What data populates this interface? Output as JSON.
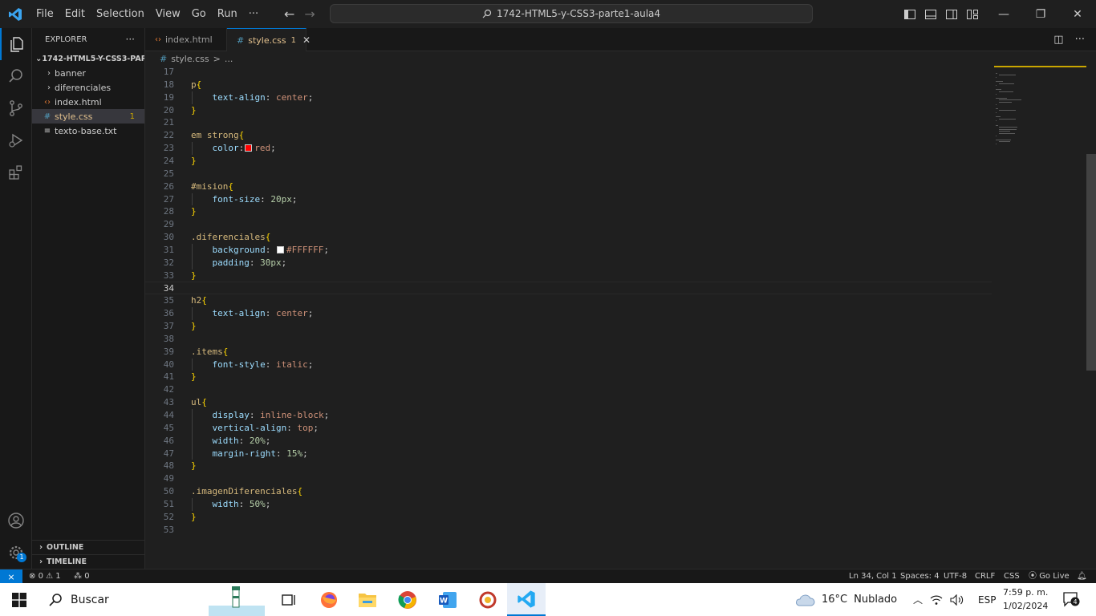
{
  "window": {
    "title": "1742-HTML5-y-CSS3-parte1-aula4",
    "menu": [
      "File",
      "Edit",
      "Selection",
      "View",
      "Go",
      "Run",
      "···"
    ],
    "controls": {
      "minimize": "—",
      "restore": "❐",
      "close": "✕"
    }
  },
  "explorer": {
    "title": "EXPLORER",
    "more": "···",
    "root": "1742-HTML5-Y-CSS3-PAR...",
    "items": [
      {
        "label": "banner",
        "type": "folder",
        "icon": "chevron-right-icon"
      },
      {
        "label": "diferenciales",
        "type": "folder",
        "icon": "chevron-right-icon"
      },
      {
        "label": "index.html",
        "type": "html",
        "icon": "html-file-icon"
      },
      {
        "label": "style.css",
        "type": "css",
        "icon": "css-file-icon",
        "problems": "1",
        "selected": true
      },
      {
        "label": "texto-base.txt",
        "type": "txt",
        "icon": "text-file-icon"
      }
    ],
    "outline": "OUTLINE",
    "timeline": "TIMELINE"
  },
  "tabs": [
    {
      "label": "index.html",
      "active": false,
      "icon": "html-file-icon"
    },
    {
      "label": "style.css",
      "active": true,
      "problems": "1",
      "close": "✕",
      "icon": "css-file-icon"
    }
  ],
  "breadcrumb": {
    "file": "style.css",
    "sep": ">",
    "rest": "..."
  },
  "editor": {
    "current_line": "34",
    "lines": [
      {
        "n": "17",
        "t": []
      },
      {
        "n": "18",
        "t": [
          [
            "sel",
            "p"
          ],
          [
            "brace",
            "{"
          ]
        ]
      },
      {
        "n": "19",
        "t": [
          [
            "ws",
            "    "
          ],
          [
            "prop",
            "text-align"
          ],
          [
            "plain",
            ": "
          ],
          [
            "val",
            "center"
          ],
          [
            "plain",
            ";"
          ]
        ]
      },
      {
        "n": "20",
        "t": [
          [
            "brace",
            "}"
          ]
        ]
      },
      {
        "n": "21",
        "t": []
      },
      {
        "n": "22",
        "t": [
          [
            "sel",
            "em strong"
          ],
          [
            "brace",
            "{"
          ]
        ]
      },
      {
        "n": "23",
        "t": [
          [
            "ws",
            "    "
          ],
          [
            "prop",
            "color"
          ],
          [
            "plain",
            ":"
          ],
          [
            "swatch",
            "#ff0000"
          ],
          [
            "val",
            "red"
          ],
          [
            "plain",
            ";"
          ]
        ]
      },
      {
        "n": "24",
        "t": [
          [
            "brace",
            "}"
          ]
        ]
      },
      {
        "n": "25",
        "t": []
      },
      {
        "n": "26",
        "t": [
          [
            "sel",
            "#mision"
          ],
          [
            "brace",
            "{"
          ]
        ]
      },
      {
        "n": "27",
        "t": [
          [
            "ws",
            "    "
          ],
          [
            "prop",
            "font-size"
          ],
          [
            "plain",
            ": "
          ],
          [
            "num",
            "20px"
          ],
          [
            "plain",
            ";"
          ]
        ]
      },
      {
        "n": "28",
        "t": [
          [
            "brace",
            "}"
          ]
        ]
      },
      {
        "n": "29",
        "t": []
      },
      {
        "n": "30",
        "t": [
          [
            "sel",
            ".diferenciales"
          ],
          [
            "brace",
            "{"
          ]
        ]
      },
      {
        "n": "31",
        "t": [
          [
            "ws",
            "    "
          ],
          [
            "prop",
            "background"
          ],
          [
            "plain",
            ": "
          ],
          [
            "swatch",
            "#ffffff"
          ],
          [
            "val",
            "#FFFFFF"
          ],
          [
            "plain",
            ";"
          ]
        ]
      },
      {
        "n": "32",
        "t": [
          [
            "ws",
            "    "
          ],
          [
            "prop",
            "padding"
          ],
          [
            "plain",
            ": "
          ],
          [
            "num",
            "30px"
          ],
          [
            "plain",
            ";"
          ]
        ]
      },
      {
        "n": "33",
        "t": [
          [
            "brace",
            "}"
          ]
        ]
      },
      {
        "n": "34",
        "t": []
      },
      {
        "n": "35",
        "t": [
          [
            "sel",
            "h2"
          ],
          [
            "brace",
            "{"
          ]
        ]
      },
      {
        "n": "36",
        "t": [
          [
            "ws",
            "    "
          ],
          [
            "prop",
            "text-align"
          ],
          [
            "plain",
            ": "
          ],
          [
            "val",
            "center"
          ],
          [
            "plain",
            ";"
          ]
        ]
      },
      {
        "n": "37",
        "t": [
          [
            "brace",
            "}"
          ]
        ]
      },
      {
        "n": "38",
        "t": []
      },
      {
        "n": "39",
        "t": [
          [
            "sel",
            ".items"
          ],
          [
            "brace",
            "{"
          ]
        ]
      },
      {
        "n": "40",
        "t": [
          [
            "ws",
            "    "
          ],
          [
            "prop",
            "font-style"
          ],
          [
            "plain",
            ": "
          ],
          [
            "val",
            "italic"
          ],
          [
            "plain",
            ";"
          ]
        ]
      },
      {
        "n": "41",
        "t": [
          [
            "brace",
            "}"
          ]
        ]
      },
      {
        "n": "42",
        "t": []
      },
      {
        "n": "43",
        "t": [
          [
            "sel",
            "ul"
          ],
          [
            "brace",
            "{"
          ]
        ]
      },
      {
        "n": "44",
        "t": [
          [
            "ws",
            "    "
          ],
          [
            "prop",
            "display"
          ],
          [
            "plain",
            ": "
          ],
          [
            "val",
            "inline-block"
          ],
          [
            "plain",
            ";"
          ]
        ]
      },
      {
        "n": "45",
        "t": [
          [
            "ws",
            "    "
          ],
          [
            "prop",
            "vertical-align"
          ],
          [
            "plain",
            ": "
          ],
          [
            "val",
            "top"
          ],
          [
            "plain",
            ";"
          ]
        ]
      },
      {
        "n": "46",
        "t": [
          [
            "ws",
            "    "
          ],
          [
            "prop",
            "width"
          ],
          [
            "plain",
            ": "
          ],
          [
            "num",
            "20%"
          ],
          [
            "plain",
            ";"
          ]
        ]
      },
      {
        "n": "47",
        "t": [
          [
            "ws",
            "    "
          ],
          [
            "prop",
            "margin-right"
          ],
          [
            "plain",
            ": "
          ],
          [
            "num",
            "15%"
          ],
          [
            "plain",
            ";"
          ]
        ]
      },
      {
        "n": "48",
        "t": [
          [
            "brace",
            "}"
          ]
        ]
      },
      {
        "n": "49",
        "t": []
      },
      {
        "n": "50",
        "t": [
          [
            "sel",
            ".imagenDiferenciales"
          ],
          [
            "brace",
            "{"
          ]
        ]
      },
      {
        "n": "51",
        "t": [
          [
            "ws",
            "    "
          ],
          [
            "prop",
            "width"
          ],
          [
            "plain",
            ": "
          ],
          [
            "num",
            "50%"
          ],
          [
            "plain",
            ";"
          ]
        ]
      },
      {
        "n": "52",
        "t": [
          [
            "brace",
            "}"
          ]
        ]
      },
      {
        "n": "53",
        "t": []
      }
    ]
  },
  "statusbar": {
    "errors": "0",
    "warnings": "1",
    "ports": "0",
    "position": "Ln 34, Col 1",
    "spaces": "Spaces: 4",
    "encoding": "UTF-8",
    "eol": "CRLF",
    "language": "CSS",
    "golive": "Go Live"
  },
  "taskbar": {
    "search": "Buscar",
    "apps": [
      "task-view-icon",
      "firefox-icon",
      "file-explorer-icon",
      "chrome-icon",
      "word-icon",
      "paint-app-icon",
      "vscode-icon"
    ],
    "temperature": "16°C",
    "weather": "Nublado",
    "language": "ESP",
    "time": "7:59 p. m.",
    "date": "1/02/2024",
    "notifications": "4"
  },
  "colors": {
    "accent": "#0078d4",
    "warning": "#e2c08d",
    "editor_bg": "#1f1f1f"
  }
}
